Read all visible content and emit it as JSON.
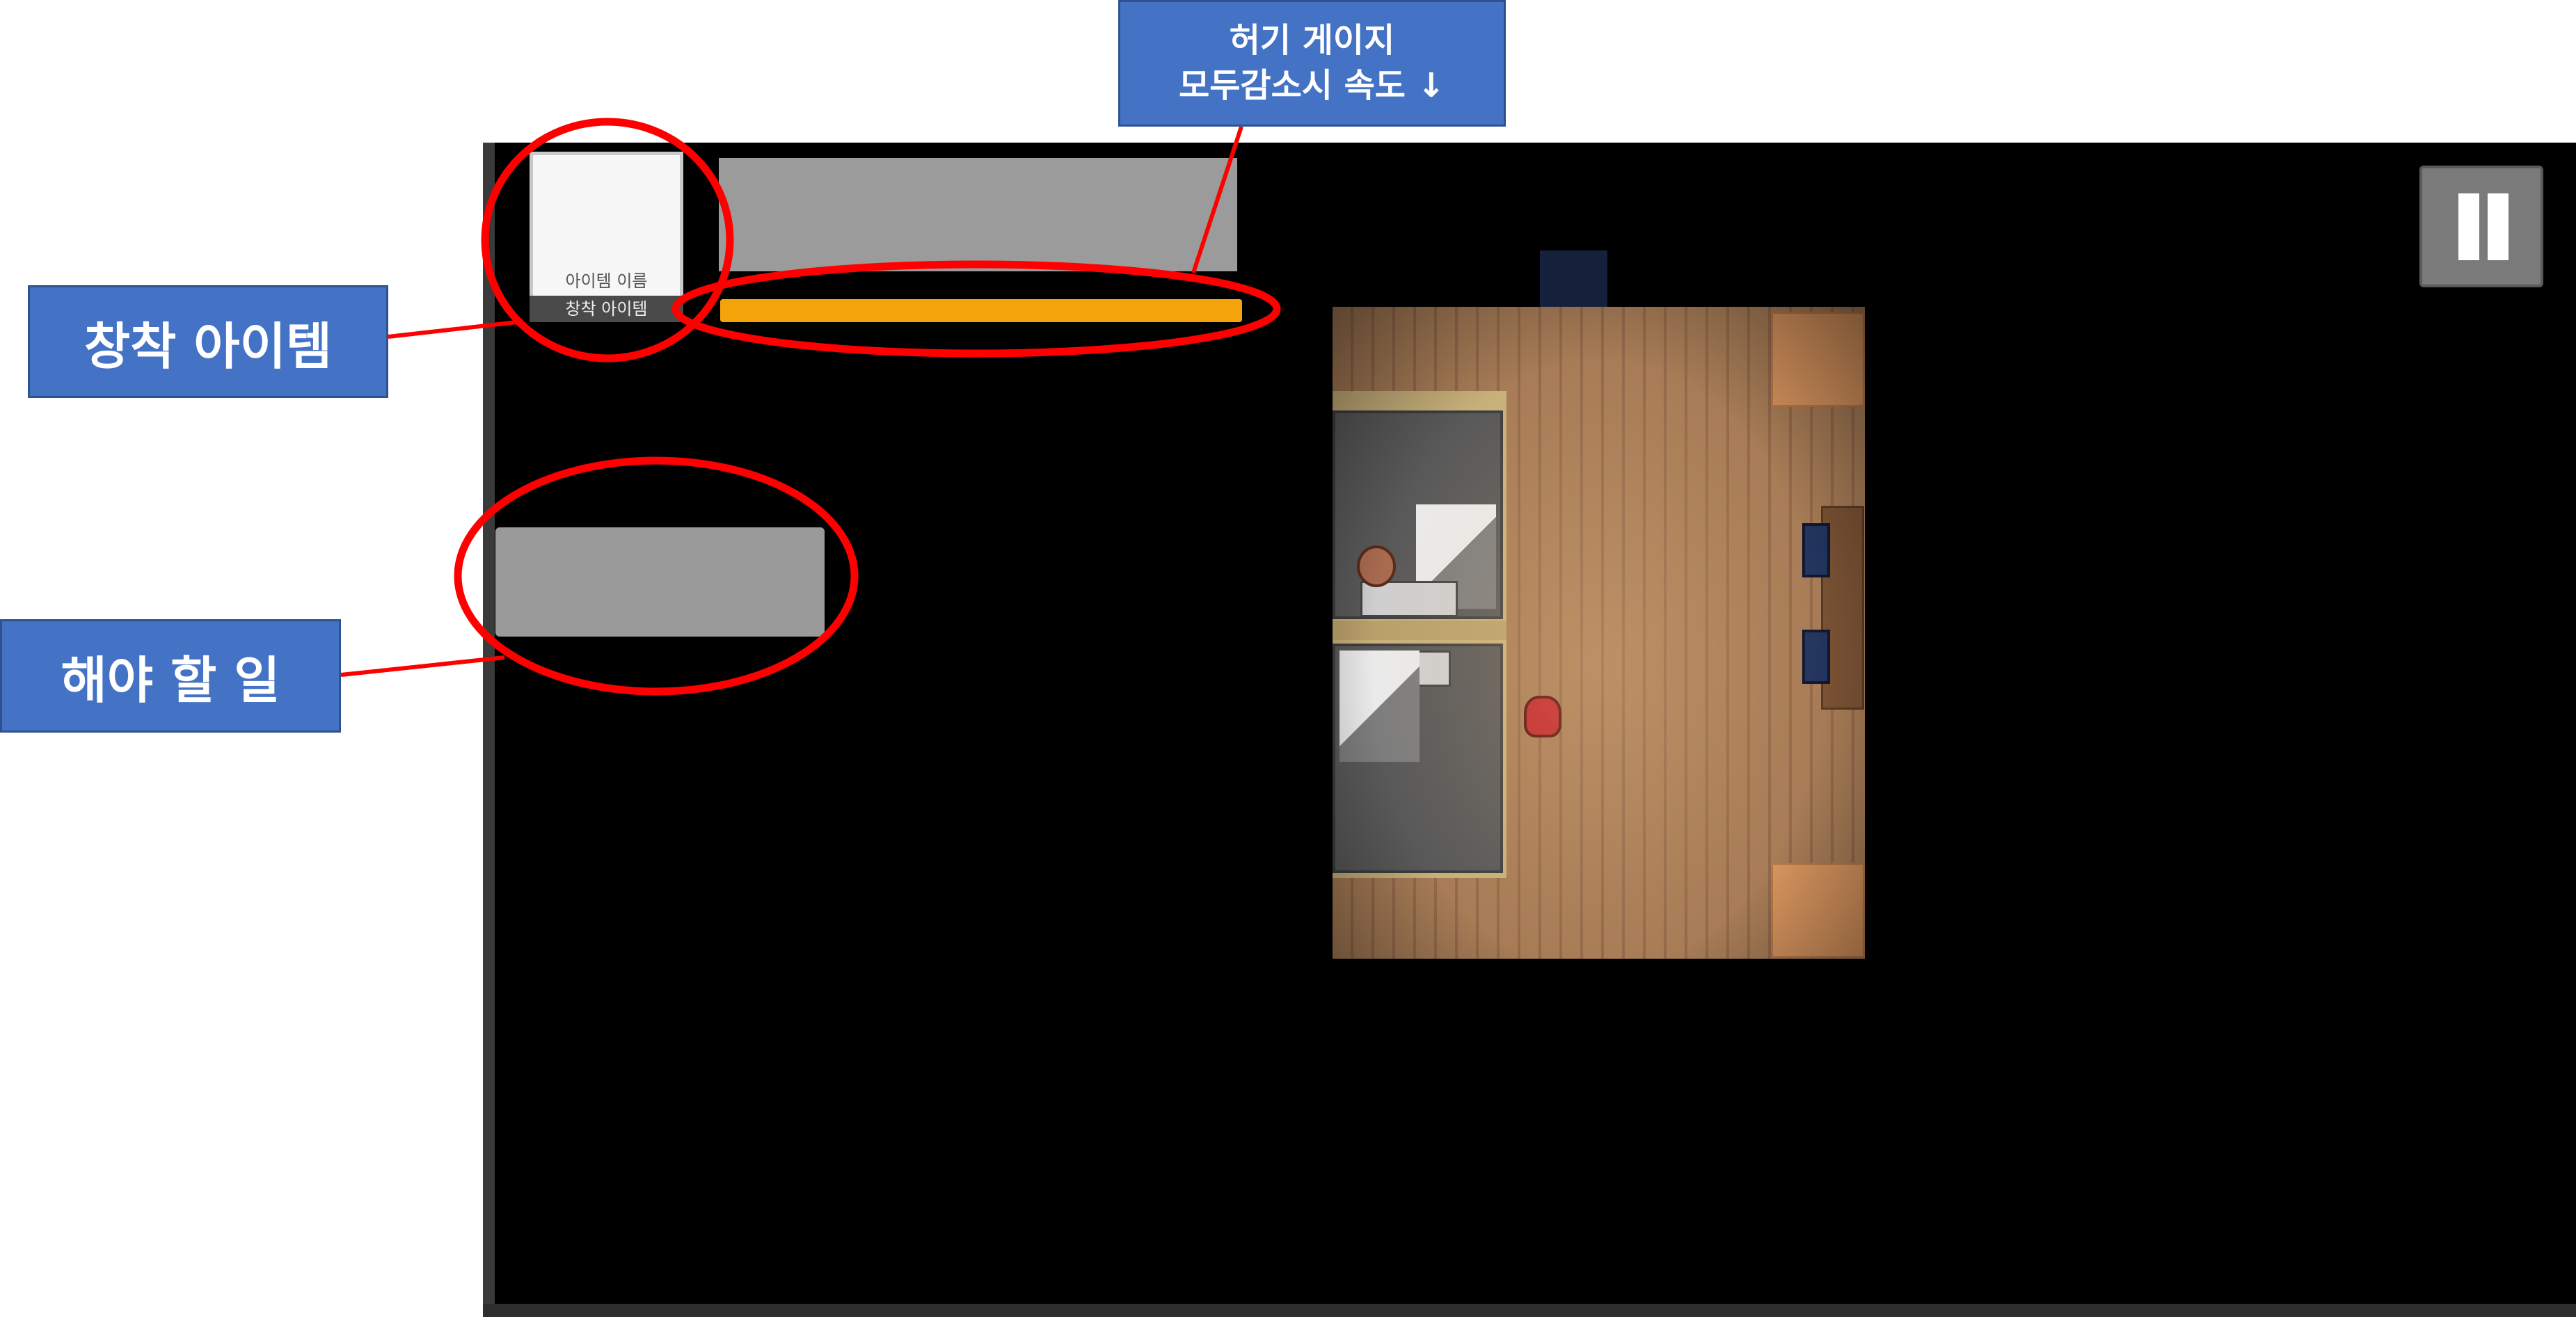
{
  "annotations": {
    "equipped_item_label": "창착 아이템",
    "todo_label": "해야 할 일",
    "hunger_line1": "허기 게이지",
    "hunger_line2": "모두감소시 속도 ↓"
  },
  "hud": {
    "item_name": "아이템 이름",
    "equipped_item_caption": "창착 아이템",
    "hunger_fill_fraction": 1.0
  },
  "colors": {
    "annotation_box": "#4472c4",
    "circle_stroke": "#ff0000",
    "hunger_bar": "#f5a30a"
  },
  "icons": {
    "pause": "pause-icon"
  }
}
